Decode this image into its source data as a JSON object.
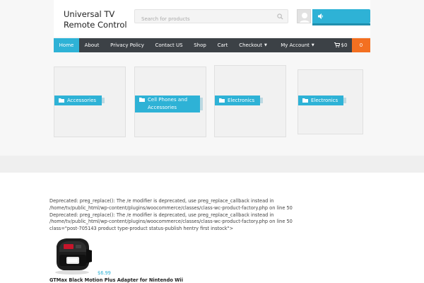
{
  "header": {
    "site_title": "Universal TV Remote Control",
    "search_placeholder": "Search for products"
  },
  "nav": {
    "items": [
      {
        "label": "Home",
        "active": true
      },
      {
        "label": "About"
      },
      {
        "label": "Privacy Policy"
      },
      {
        "label": "Contact US"
      },
      {
        "label": "Shop"
      },
      {
        "label": "Cart"
      },
      {
        "label": "Checkout",
        "dropdown": true
      },
      {
        "label": "My Account",
        "dropdown": true
      }
    ],
    "cart_total": "$0",
    "cart_count": "0"
  },
  "categories": [
    {
      "label": "Accessories"
    },
    {
      "label": "Cell Phones and Accessories"
    },
    {
      "label": "Electronics"
    },
    {
      "label": "Electronics"
    }
  ],
  "notices": {
    "line1": "Deprecated: preg_replace(): The /e modifier is deprecated, use preg_replace_callback instead in /home/tv/public_html/wp-content/plugins/woocommerce/classes/class-wc-product-factory.php on line 50",
    "line2": "Deprecated: preg_replace(): The /e modifier is deprecated, use preg_replace_callback instead in /home/tv/public_html/wp-content/plugins/woocommerce/classes/class-wc-product-factory.php on line 50",
    "line3": "class=\"post-705143 product type-product status-publish hentry first instock\">"
  },
  "product": {
    "price": "$6.99",
    "title": "GTMax Black Motion Plus Adapter for Nintendo Wii"
  },
  "colors": {
    "accent": "#2eb2d6",
    "nav_bg": "#3c4146",
    "cart_badge": "#f37021"
  }
}
